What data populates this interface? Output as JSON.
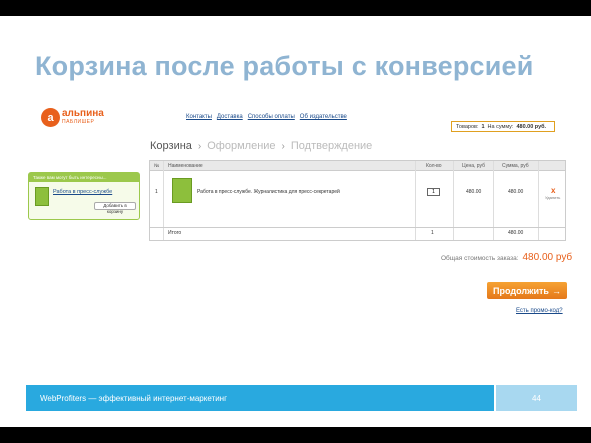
{
  "slide": {
    "title": "Корзина после работы с конверсией",
    "footer_text": "WebProfiters — эффективный интернет-маркетинг",
    "page_number": "44"
  },
  "shop": {
    "logo": {
      "mark": "a",
      "name": "альпина",
      "sub": "ПАБЛИШЕР"
    },
    "nav": [
      "Контакты",
      "Доставка",
      "Способы оплаты",
      "Об издательстве"
    ],
    "cart_mini": {
      "goods_label": "Товаров:",
      "goods_count": "1",
      "sum_label": "На сумму:",
      "sum_value": "480.00 руб."
    },
    "steps": [
      "Корзина",
      "Оформление",
      "Подтверждение"
    ],
    "step_separator": "›",
    "promo": {
      "header": "Также вам могут быть интересны...",
      "book_title": "Работа в пресс-службе",
      "add_button": "Добавить в корзину"
    },
    "table": {
      "headers": [
        "№",
        "Наименование",
        "Кол-во",
        "Цена, руб",
        "Сумма, руб"
      ],
      "rows": [
        {
          "num": "1",
          "name": "Работа в пресс-службе. Журналистика для пресс-секретарей",
          "qty": "1",
          "price": "480.00",
          "sum": "480.00",
          "remove_icon": "x",
          "remove_label": "Удалить"
        }
      ],
      "total_row": {
        "label": "Итого",
        "qty": "1",
        "sum": "480.00"
      }
    },
    "total_label": "Общая стоимость заказа:",
    "total_value": "480.00 руб",
    "continue_button": "Продолжить",
    "continue_arrow": "→",
    "promo_link": "Есть промо-код?"
  },
  "colors": {
    "title": "#8fb4d2",
    "accent_orange": "#e8601c",
    "footer_blue": "#29a9df",
    "promo_green": "#9cc84c"
  }
}
